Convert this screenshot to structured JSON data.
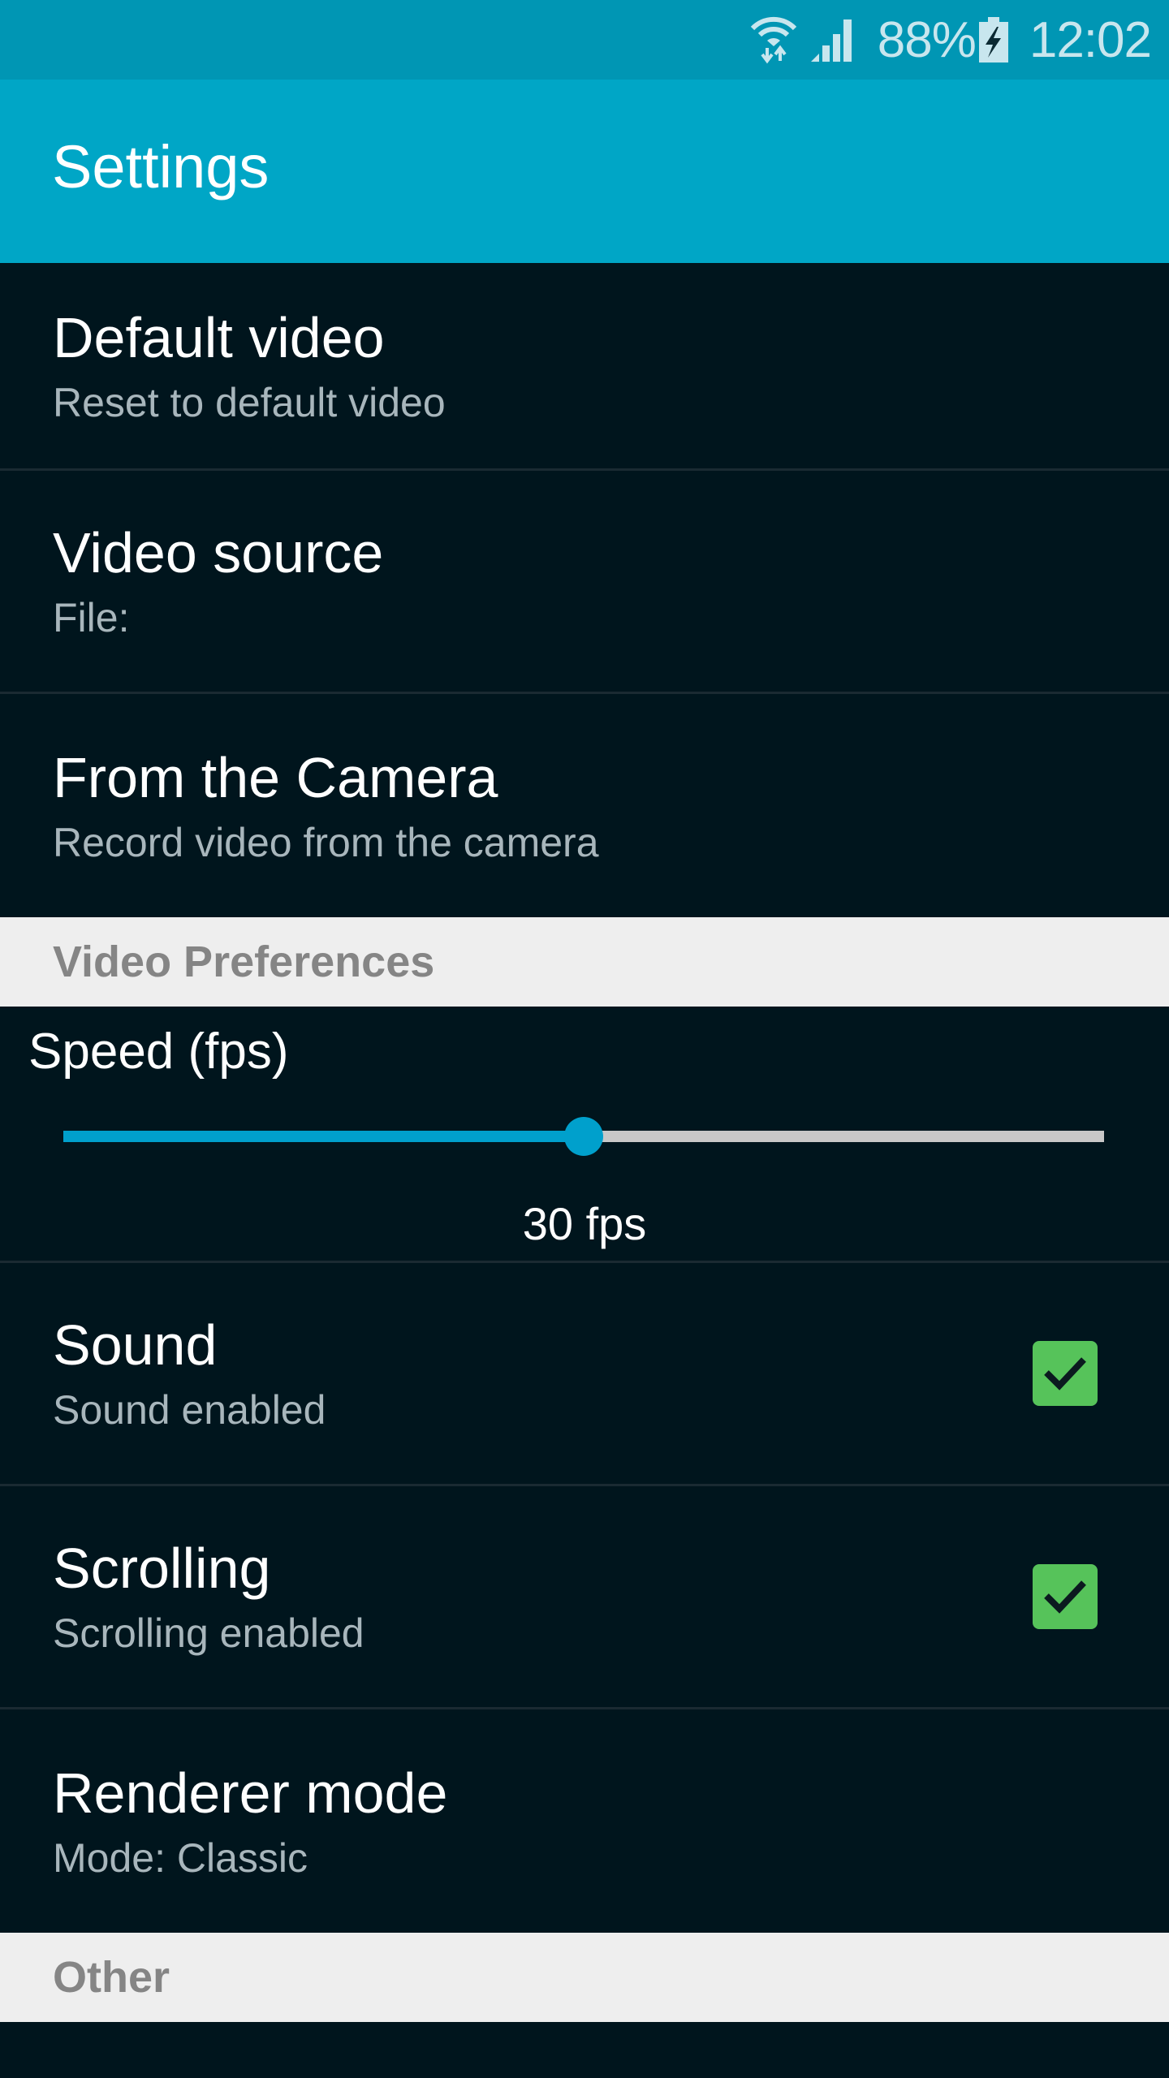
{
  "status_bar": {
    "wifi_icon": "wifi-data-icon",
    "signal_icon": "cell-signal-icon",
    "battery_percent": "88%",
    "battery_icon": "battery-charging-icon",
    "time": "12:02"
  },
  "app_bar": {
    "title": "Settings"
  },
  "items_top": [
    {
      "title": "Default video",
      "summary": "Reset to default video"
    },
    {
      "title": "Video source",
      "summary": "File:"
    },
    {
      "title": "From the Camera",
      "summary": "Record video from the camera"
    }
  ],
  "categories": {
    "video_preferences": "Video Preferences",
    "other": "Other"
  },
  "speed": {
    "title": "Speed (fps)",
    "value_label": "30 fps",
    "fill_fraction": 0.5
  },
  "items_bottom": [
    {
      "title": "Sound",
      "summary": "Sound enabled",
      "checked": true
    },
    {
      "title": "Scrolling",
      "summary": "Scrolling enabled",
      "checked": true
    },
    {
      "title": "Renderer mode",
      "summary": "Mode: Classic"
    }
  ],
  "colors": {
    "status_bar": "#0096b4",
    "app_bar": "#00a6c6",
    "background": "#00151d",
    "accent": "#00a0cc",
    "checkbox": "#56c35a",
    "category_bg": "#eeeeee"
  }
}
